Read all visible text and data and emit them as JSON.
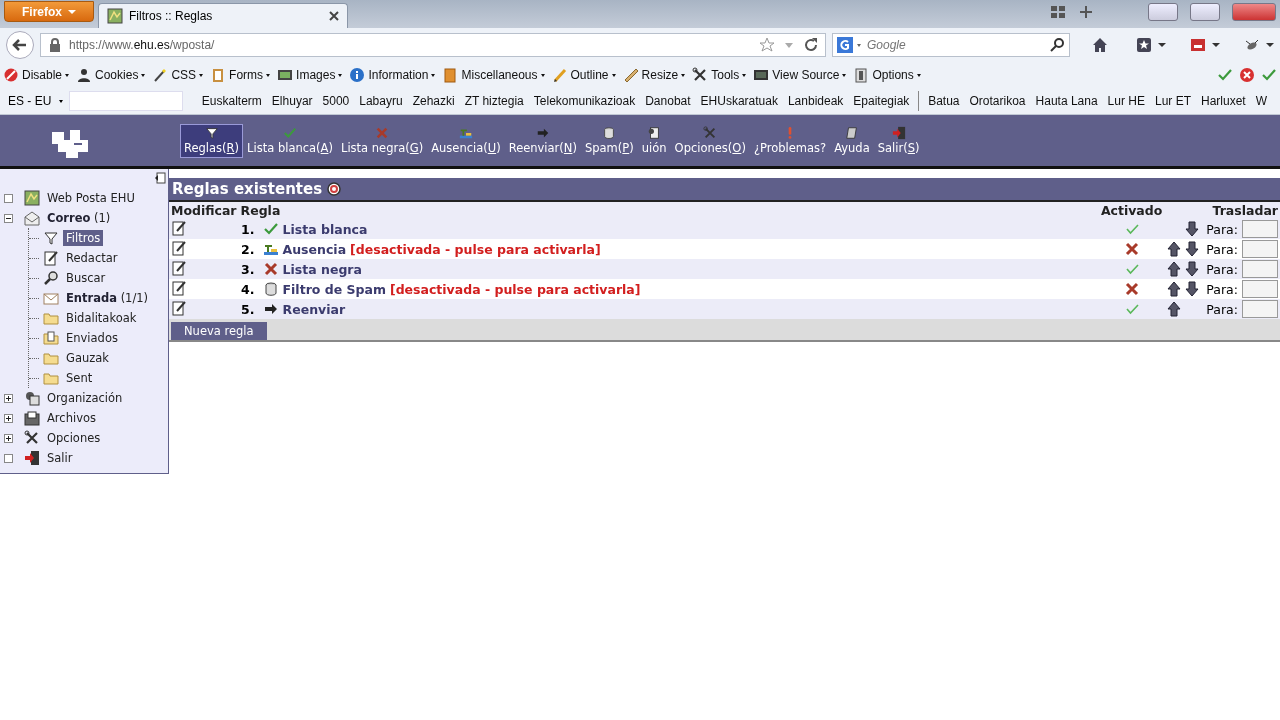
{
  "browser": {
    "menu_button": "Firefox",
    "tab": {
      "title": "Filtros :: Reglas"
    },
    "url": {
      "prefix": "https://www.",
      "domain": "ehu.es",
      "path": "/wposta/"
    },
    "search": {
      "placeholder": "Google"
    }
  },
  "dev_toolbar": [
    {
      "label": "Disable",
      "kind": "disable"
    },
    {
      "label": "Cookies",
      "kind": "person"
    },
    {
      "label": "CSS",
      "kind": "wand"
    },
    {
      "label": "Forms",
      "kind": "clipboard"
    },
    {
      "label": "Images",
      "kind": "picture"
    },
    {
      "label": "Information",
      "kind": "info"
    },
    {
      "label": "Miscellaneous",
      "kind": "book"
    },
    {
      "label": "Outline",
      "kind": "pencil"
    },
    {
      "label": "Resize",
      "kind": "ruler"
    },
    {
      "label": "Tools",
      "kind": "tools"
    },
    {
      "label": "View Source",
      "kind": "monitor"
    },
    {
      "label": "Options",
      "kind": "mirror"
    }
  ],
  "bookmarks": {
    "language": "ES - EU",
    "items": [
      {
        "label": "Euskalterm",
        "separator_before": false
      },
      {
        "label": "Elhuyar",
        "separator_before": false
      },
      {
        "label": "5000",
        "separator_before": false
      },
      {
        "label": "Labayru",
        "separator_before": false
      },
      {
        "label": "Zehazki",
        "separator_before": false
      },
      {
        "label": "ZT hiztegia",
        "separator_before": false
      },
      {
        "label": "Telekomunikazioak",
        "separator_before": false
      },
      {
        "label": "Danobat",
        "separator_before": false
      },
      {
        "label": "EHUskaratuak",
        "separator_before": false
      },
      {
        "label": "Lanbideak",
        "separator_before": false
      },
      {
        "label": "Epaitegiak",
        "separator_before": false
      },
      {
        "label": "Batua",
        "separator_before": true
      },
      {
        "label": "Orotarikoa",
        "separator_before": false
      },
      {
        "label": "Hauta Lana",
        "separator_before": false
      },
      {
        "label": "Lur HE",
        "separator_before": false
      },
      {
        "label": "Lur ET",
        "separator_before": false
      },
      {
        "label": "Harluxet",
        "separator_before": false
      },
      {
        "label": "W",
        "separator_before": false
      }
    ]
  },
  "app_nav": [
    {
      "label": "Reglas",
      "accesskey": "(R)",
      "kind": "filter",
      "selected": true
    },
    {
      "label": "Lista blanca",
      "accesskey": "(A)",
      "kind": "check",
      "selected": false
    },
    {
      "label": "Lista negra",
      "accesskey": "(G)",
      "kind": "cross",
      "selected": false
    },
    {
      "label": "Ausencia",
      "accesskey": "(U)",
      "kind": "beach",
      "selected": false
    },
    {
      "label": "Reenviar",
      "accesskey": "(N)",
      "kind": "arrow",
      "selected": false
    },
    {
      "label": "Spam",
      "accesskey": "(P)",
      "kind": "can",
      "selected": false
    },
    {
      "label": "uión",
      "kind": "scroll",
      "selected": false
    },
    {
      "label": "Opciones",
      "accesskey": "(O)",
      "kind": "tools",
      "selected": false
    },
    {
      "label": "¿Problemas?",
      "kind": "exclamation",
      "selected": false
    },
    {
      "label": "Ayuda",
      "kind": "manual",
      "selected": false
    },
    {
      "label": "Salir",
      "accesskey": "(S)",
      "kind": "exit",
      "selected": false
    }
  ],
  "sidebar": {
    "tree": [
      {
        "label": "Web Posta EHU",
        "kind": "map",
        "unread": false,
        "selected": false
      },
      {
        "label": "Correo",
        "count": "(1)",
        "kind": "mail-open",
        "expanded": true,
        "unread": true,
        "selected": false,
        "children": [
          {
            "label": "Filtros",
            "kind": "filter",
            "unread": false,
            "selected": true
          },
          {
            "label": "Redactar",
            "kind": "compose",
            "unread": false,
            "selected": false
          },
          {
            "label": "Buscar",
            "kind": "magnifier",
            "unread": false,
            "selected": false
          },
          {
            "label": "Entrada",
            "count": "(1/1)",
            "kind": "envelope",
            "unread": true,
            "selected": false
          },
          {
            "label": "Bidalitakoak",
            "kind": "folder",
            "unread": false,
            "selected": false
          },
          {
            "label": "Enviados",
            "kind": "folder-doc",
            "unread": false,
            "selected": false
          },
          {
            "label": "Gauzak",
            "kind": "folder",
            "unread": false,
            "selected": false
          },
          {
            "label": "Sent",
            "kind": "folder",
            "unread": false,
            "selected": false
          }
        ]
      },
      {
        "label": "Organización",
        "kind": "organizer",
        "expanded": false,
        "unread": false,
        "selected": false
      },
      {
        "label": "Archivos",
        "kind": "file-box",
        "expanded": false,
        "unread": false,
        "selected": false
      },
      {
        "label": "Opciones",
        "kind": "tools",
        "expanded": false,
        "unread": false,
        "selected": false
      },
      {
        "label": "Salir",
        "kind": "exit",
        "unread": false,
        "selected": false
      }
    ]
  },
  "rules_panel": {
    "title": "Reglas existentes",
    "columns": [
      "Modificar",
      "Regla",
      "Activado",
      "Trasladar"
    ],
    "rows": [
      {
        "number": "1.",
        "kind": "check",
        "name": "Lista blanca",
        "active": true,
        "move_up": false,
        "move_down": true,
        "target_label": "Para:"
      },
      {
        "number": "2.",
        "kind": "beach",
        "name": "Ausencia",
        "note": "[desactivada - pulse para activarla]",
        "active": false,
        "move_up": true,
        "move_down": true,
        "target_label": "Para:"
      },
      {
        "number": "3.",
        "kind": "cross",
        "name": "Lista negra",
        "active": true,
        "move_up": true,
        "move_down": true,
        "target_label": "Para:"
      },
      {
        "number": "4.",
        "kind": "can",
        "name": "Filtro de Spam",
        "note": "[desactivada - pulse para activarla]",
        "active": false,
        "move_up": true,
        "move_down": true,
        "target_label": "Para:"
      },
      {
        "number": "5.",
        "kind": "arrow",
        "name": "Reenviar",
        "active": true,
        "move_up": true,
        "move_down": false,
        "target_label": "Para:"
      }
    ],
    "new_button": "Nueva regla"
  }
}
